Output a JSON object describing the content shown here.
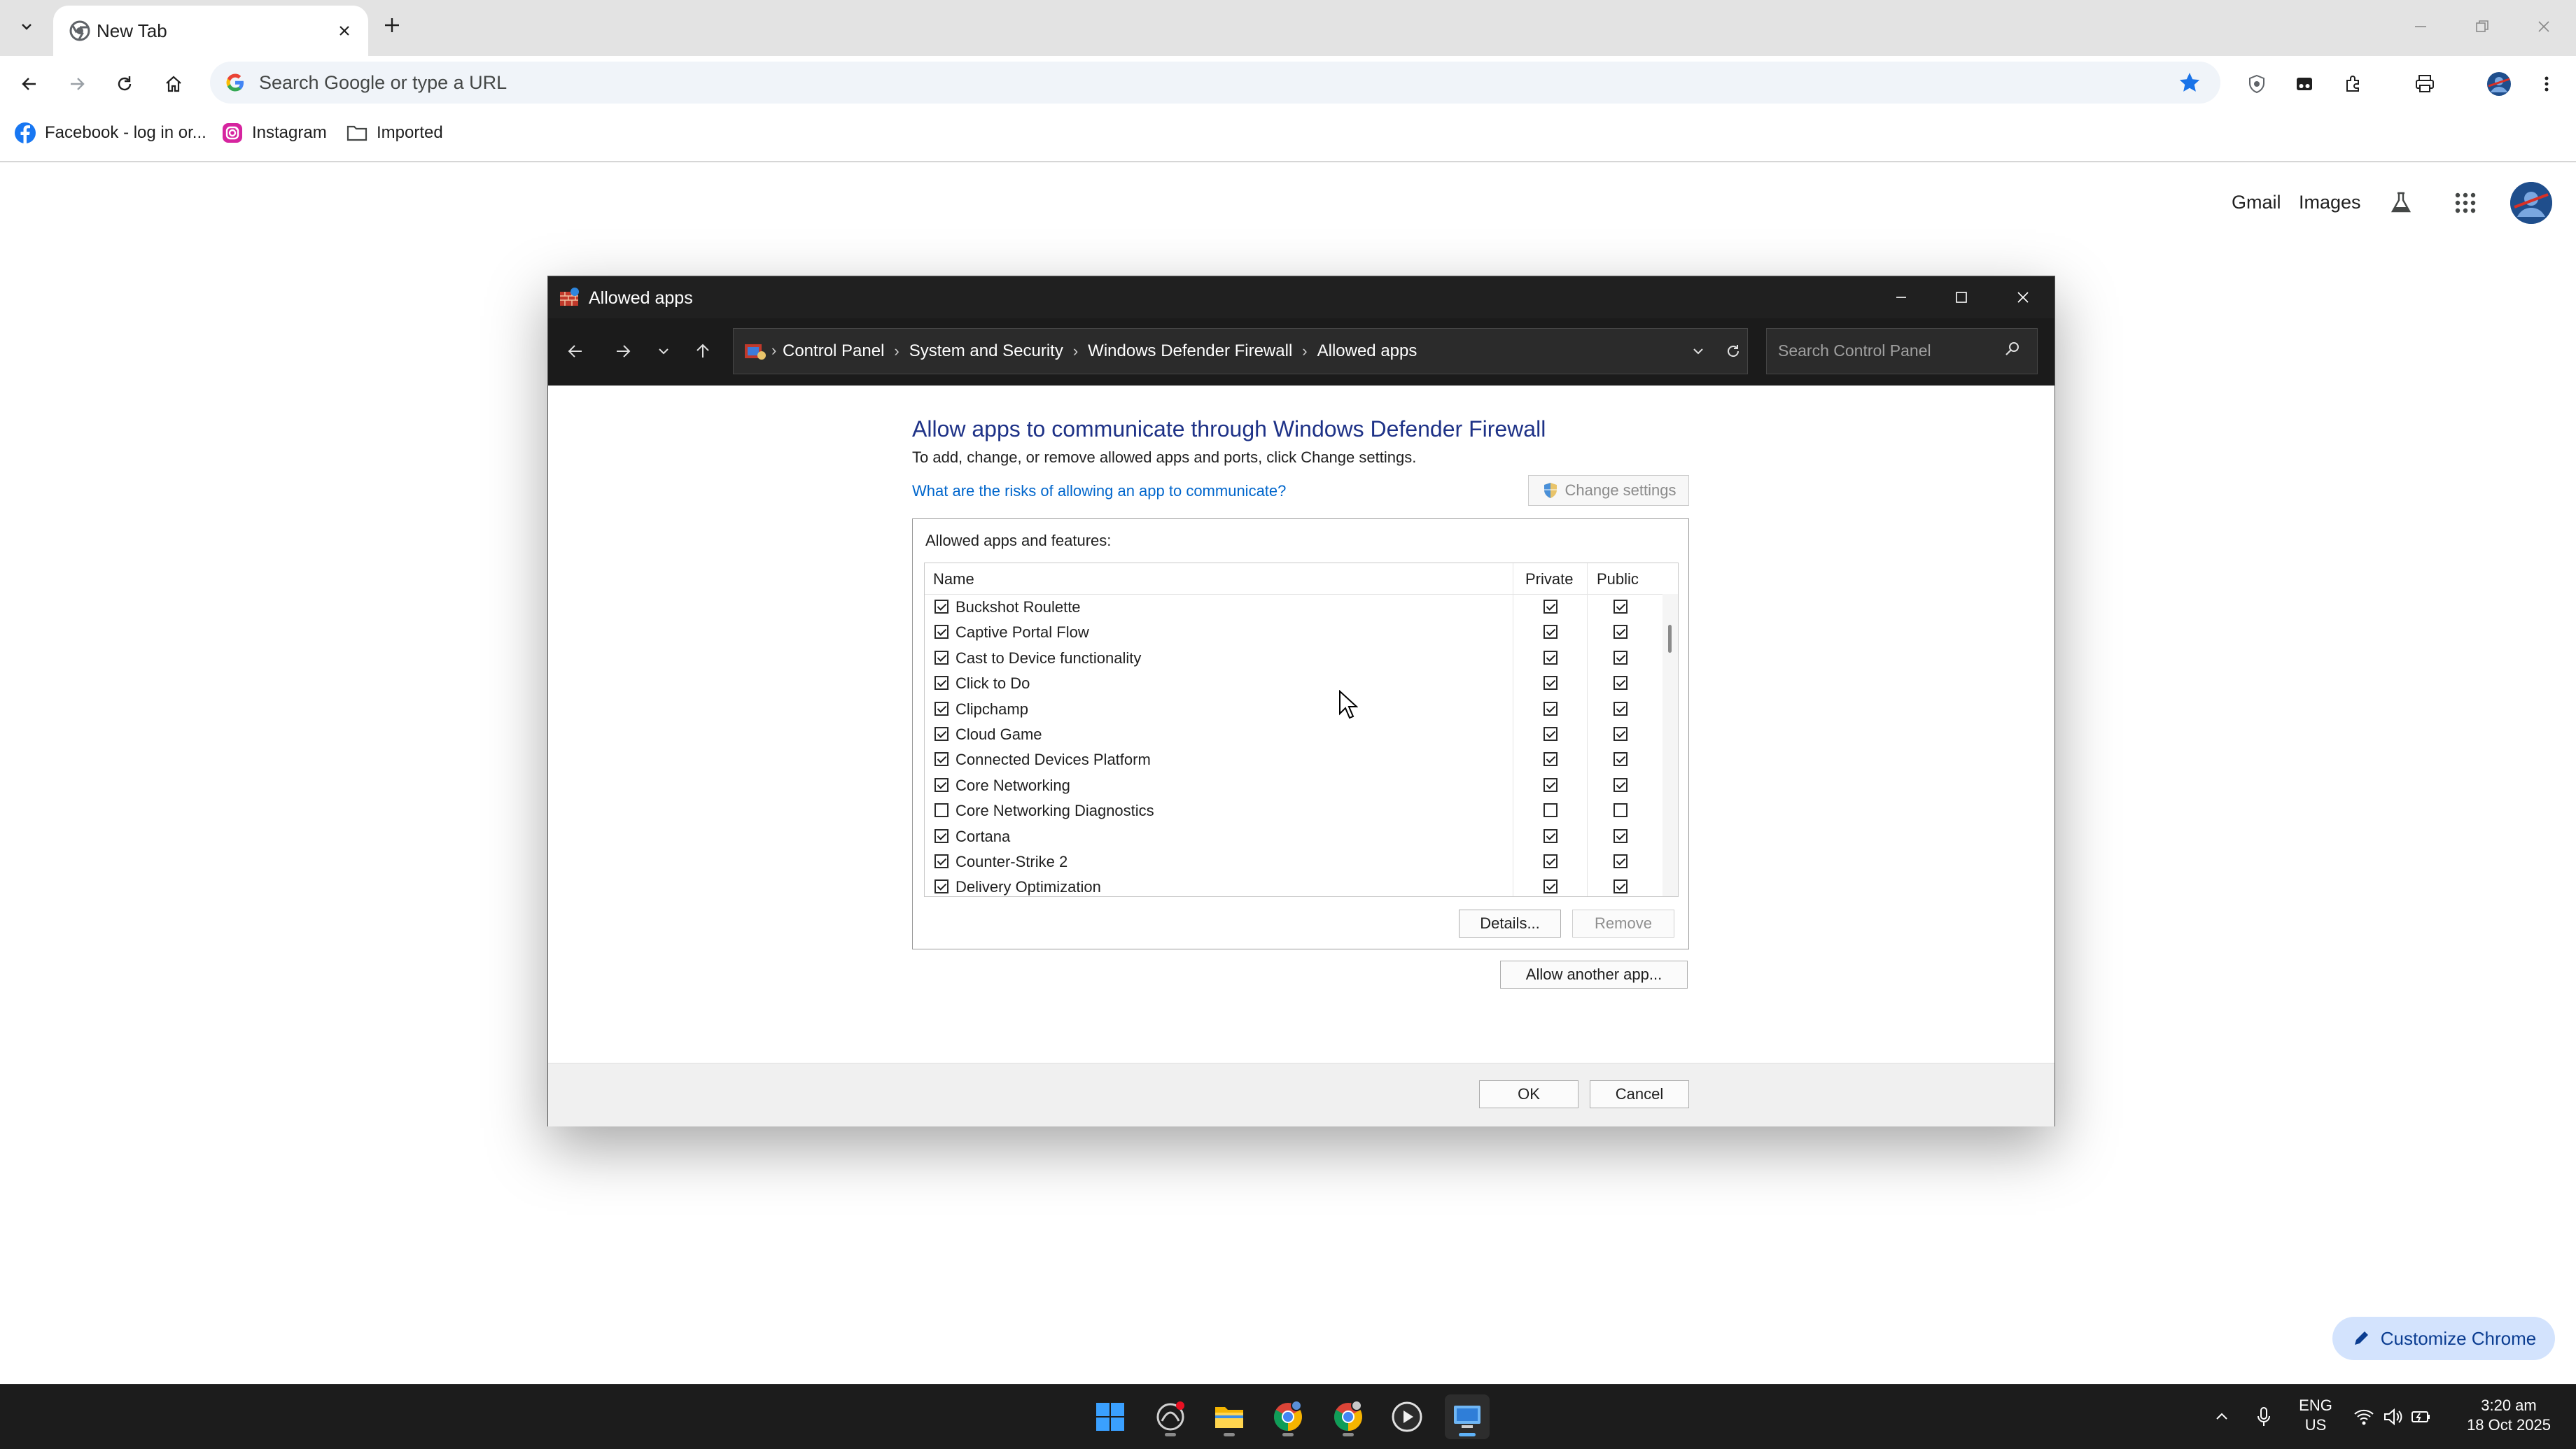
{
  "browser": {
    "tab": {
      "title": "New Tab"
    },
    "omnibox": {
      "placeholder": "Search Google or type a URL"
    },
    "bookmarks": [
      {
        "label": "Facebook - log in or...",
        "icon": "facebook-icon"
      },
      {
        "label": "Instagram",
        "icon": "instagram-icon"
      },
      {
        "label": "Imported",
        "icon": "folder-icon"
      }
    ],
    "ntp": {
      "gmail": "Gmail",
      "images": "Images"
    },
    "customize_label": "Customize Chrome"
  },
  "dialog": {
    "title": "Allowed apps",
    "breadcrumbs": [
      "Control Panel",
      "System and Security",
      "Windows Defender Firewall",
      "Allowed apps"
    ],
    "search_placeholder": "Search Control Panel",
    "heading": "Allow apps to communicate through Windows Defender Firewall",
    "subtext": "To add, change, or remove allowed apps and ports, click Change settings.",
    "risk_link": "What are the risks of allowing an app to communicate?",
    "change_settings": "Change settings",
    "group_label": "Allowed apps and features:",
    "columns": {
      "name": "Name",
      "private": "Private",
      "public": "Public"
    },
    "rows": [
      {
        "name": "Buckshot Roulette",
        "enabled": true,
        "private": true,
        "public": true
      },
      {
        "name": "Captive Portal Flow",
        "enabled": true,
        "private": true,
        "public": true
      },
      {
        "name": "Cast to Device functionality",
        "enabled": true,
        "private": true,
        "public": true
      },
      {
        "name": "Click to Do",
        "enabled": true,
        "private": true,
        "public": true
      },
      {
        "name": "Clipchamp",
        "enabled": true,
        "private": true,
        "public": true
      },
      {
        "name": "Cloud Game",
        "enabled": true,
        "private": true,
        "public": true
      },
      {
        "name": "Connected Devices Platform",
        "enabled": true,
        "private": true,
        "public": true
      },
      {
        "name": "Core Networking",
        "enabled": true,
        "private": true,
        "public": true
      },
      {
        "name": "Core Networking Diagnostics",
        "enabled": false,
        "private": false,
        "public": false
      },
      {
        "name": "Cortana",
        "enabled": true,
        "private": true,
        "public": true
      },
      {
        "name": "Counter-Strike 2",
        "enabled": true,
        "private": true,
        "public": true
      },
      {
        "name": "Delivery Optimization",
        "enabled": true,
        "private": true,
        "public": true
      }
    ],
    "details_btn": "Details...",
    "remove_btn": "Remove",
    "allow_another_btn": "Allow another app...",
    "ok_btn": "OK",
    "cancel_btn": "Cancel"
  },
  "taskbar": {
    "lang_line1": "ENG",
    "lang_line2": "US",
    "time": "3:20 am",
    "date": "18 Oct 2025",
    "apps": [
      "start-icon",
      "app-icon",
      "file-explorer-icon",
      "chrome-icon",
      "chrome-profile-icon",
      "media-player-icon",
      "remote-desktop-icon"
    ]
  },
  "colors": {
    "heading": "#1e3287",
    "link": "#0066cc",
    "chrome_accent": "#1a73e8",
    "taskbar": "#1c1c1c"
  }
}
